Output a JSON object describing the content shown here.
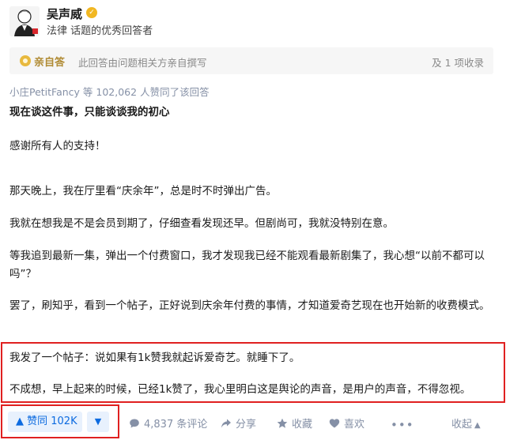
{
  "author": {
    "name": "吴声威",
    "description": "法律 话题的优秀回答者"
  },
  "notice": {
    "tag": "亲自答",
    "text": "此回答由问题相关方亲自撰写",
    "right": "及 1 项收录"
  },
  "voters_line": "小庄PetitFancy 等 102,062 人赞同了该回答",
  "answer_title": "现在谈这件事，只能谈谈我的初心",
  "paragraphs": [
    "感谢所有人的支持！",
    "那天晚上，我在厅里看“庆余年”，总是时不时弹出广告。",
    "我就在想我是不是会员到期了，仔细查看发现还早。但剧尚可，我就没特别在意。",
    "等我追到最新一集，弹出一个付费窗口，我才发现我已经不能观看最新剧集了，我心想“以前不都可以吗”？",
    "罢了，刷知乎，看到一个帖子，正好说到庆余年付费的事情，才知道爱奇艺现在也开始新的收费模式。",
    "我发了一个帖子：说如果有1k赞我就起诉爱奇艺。就睡下了。",
    "不成想，早上起来的时候，已经1k赞了，我心里明白这是舆论的声音，是用户的声音，不得忽视。"
  ],
  "actions": {
    "vote_up": "▲ 赞同 102K",
    "vote_down": "▼",
    "comments": "4,837 条评论",
    "share": "分享",
    "collect": "收藏",
    "like": "喜欢",
    "collapse": "收起"
  },
  "colors": {
    "accent": "#0d6be0",
    "highlight_border": "#e02020",
    "muted": "#8590a6"
  }
}
